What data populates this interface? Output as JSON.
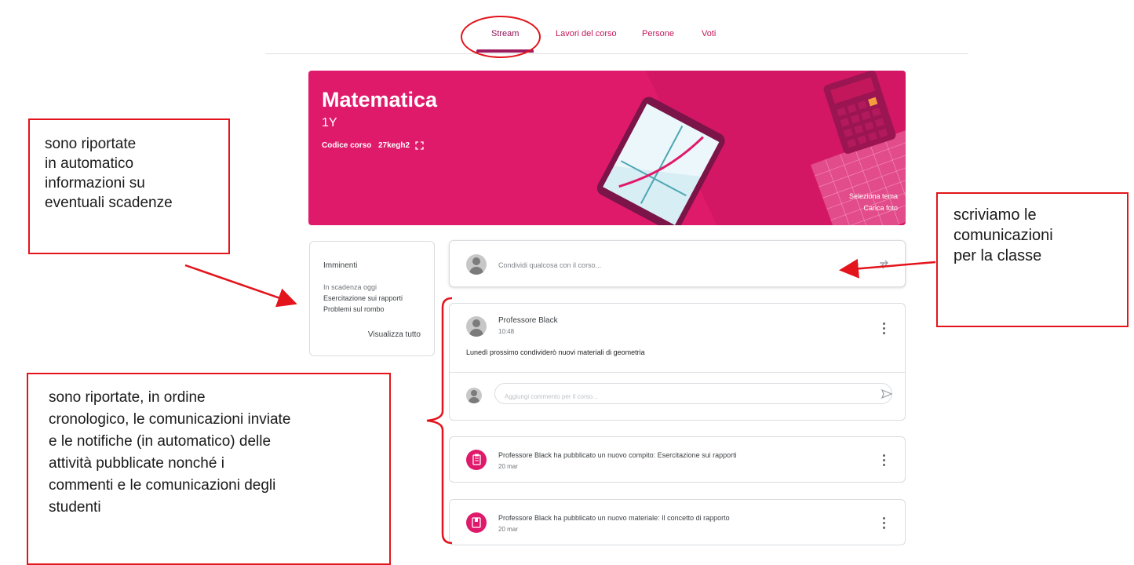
{
  "tabs": [
    {
      "label": "Stream"
    },
    {
      "label": "Lavori del corso"
    },
    {
      "label": "Persone"
    },
    {
      "label": "Voti"
    }
  ],
  "banner": {
    "title": "Matematica",
    "section": "1Y",
    "code_label": "Codice corso",
    "code_value": "27kegh2",
    "select_theme": "Seleziona tema",
    "upload_photo": "Carica foto"
  },
  "upcoming": {
    "title": "Imminenti",
    "due_today": "In scadenza oggi",
    "items": [
      "Esercitazione sui rapporti",
      "Problemi sul rombo"
    ],
    "view_all": "Visualizza tutto"
  },
  "share": {
    "placeholder": "Condividi qualcosa con il corso..."
  },
  "post": {
    "author": "Professore Black",
    "time": "10:48",
    "body": "Lunedì prossimo condividerò nuovi materiali di geometria",
    "comment_placeholder": "Aggiungi commento per il corso..."
  },
  "notifications": [
    {
      "title": "Professore Black ha pubblicato un nuovo compito: Esercitazione sui rapporti",
      "date": "20 mar",
      "icon": "assignment-icon"
    },
    {
      "title": "Professore Black ha pubblicato un nuovo materiale: Il concetto di rapporto",
      "date": "20 mar",
      "icon": "material-icon"
    }
  ],
  "annotations": {
    "upcoming": [
      "sono riportate",
      "in automatico",
      "informazioni su",
      "eventuali scadenze"
    ],
    "share": [
      "scriviamo le",
      "comunicazioni",
      "per la classe"
    ],
    "stream": [
      "sono riportate, in ordine",
      "cronologico, le comunicazioni inviate",
      "e le notifiche (in automatico) delle",
      "attività pubblicate nonché i",
      "commenti e le comunicazioni degli",
      "studenti"
    ]
  },
  "colors": {
    "accent": "#e01a6b",
    "annotation_red": "#e3141b"
  }
}
